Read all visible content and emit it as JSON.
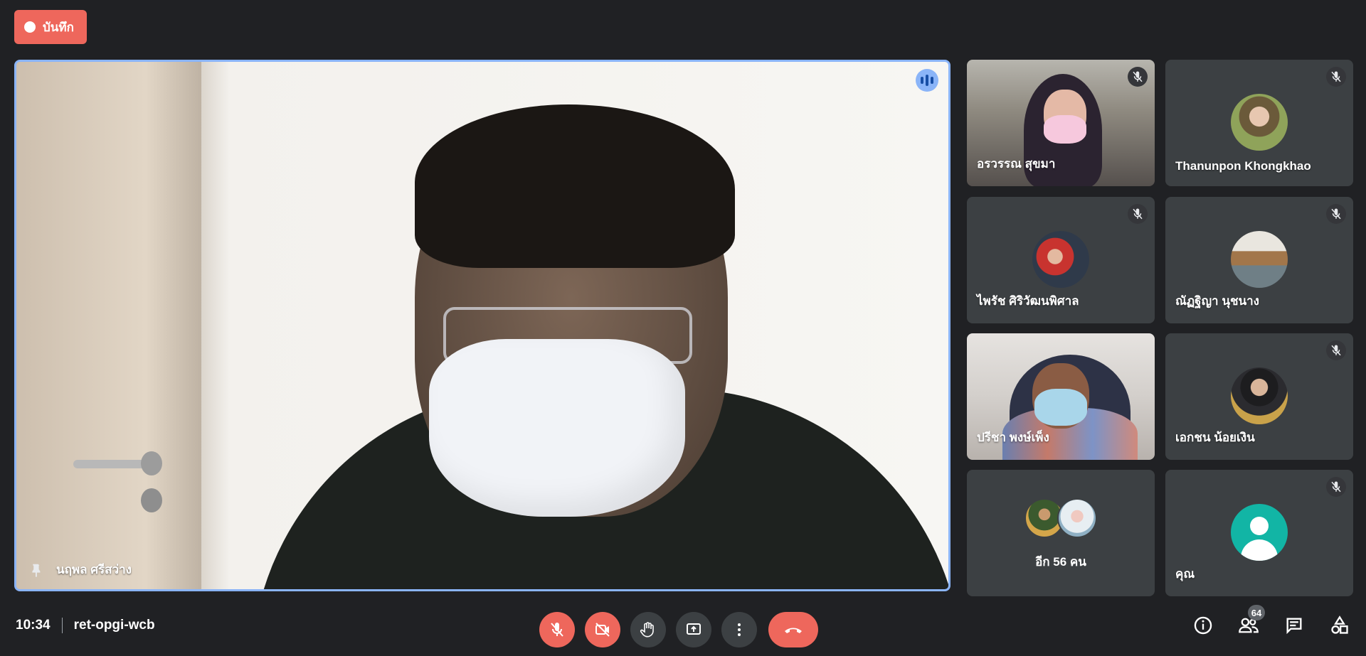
{
  "recording": {
    "label": "บันทึก"
  },
  "main_speaker": {
    "name": "นฤพล ศรีสว่าง"
  },
  "tiles": [
    {
      "name": "อรวรรณ สุขมา",
      "muted": true,
      "video": true
    },
    {
      "name": "Thanunpon Khongkhao",
      "muted": true,
      "video": false
    },
    {
      "name": "ไพรัช ศิริวัฒนพิศาล",
      "muted": true,
      "video": false
    },
    {
      "name": "ณัฏฐิญา นุชนาง",
      "muted": true,
      "video": false
    },
    {
      "name": "ปรีชา พงษ์เพ็ง",
      "muted": false,
      "video": true
    },
    {
      "name": "เอกชน น้อยเงิน",
      "muted": true,
      "video": false
    },
    {
      "name": "อีก 56 คน",
      "muted": false,
      "video": false
    },
    {
      "name": "คุณ",
      "muted": true,
      "video": false
    }
  ],
  "footer": {
    "time": "10:34",
    "meeting_code": "ret-opgi-wcb",
    "participants_count": "64"
  },
  "colors": {
    "accent": "#8ab4f8",
    "danger": "#ee675c",
    "tile_bg": "#3c4043",
    "you_avatar": "#12b5a5"
  }
}
